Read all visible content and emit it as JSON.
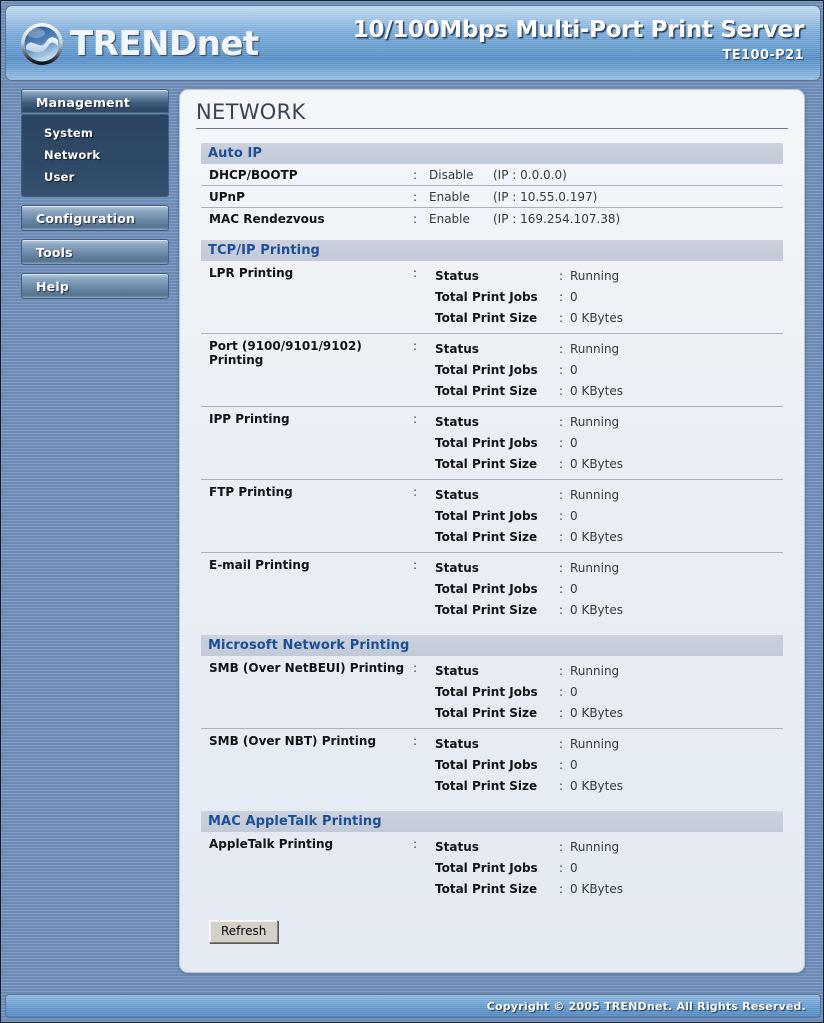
{
  "header": {
    "brand": "TRENDnet",
    "logo_icon": "trendnet-globe-logo",
    "product_title": "10/100Mbps Multi-Port Print Server",
    "model": "TE100-P21"
  },
  "sidebar": {
    "groups": [
      {
        "label": "Management",
        "active": true,
        "items": [
          {
            "label": "System"
          },
          {
            "label": "Network"
          },
          {
            "label": "User"
          }
        ]
      },
      {
        "label": "Configuration",
        "active": false,
        "items": []
      },
      {
        "label": "Tools",
        "active": false,
        "items": []
      },
      {
        "label": "Help",
        "active": false,
        "items": []
      }
    ]
  },
  "main": {
    "page_title": "NETWORK",
    "sections": [
      {
        "title": "Auto IP",
        "type": "simple",
        "rows": [
          {
            "label": "DHCP/BOOTP",
            "colon": ":",
            "value": "Disable",
            "extra": "(IP : 0.0.0.0)"
          },
          {
            "label": "UPnP",
            "colon": ":",
            "value": "Enable",
            "extra": "(IP : 10.55.0.197)"
          },
          {
            "label": "MAC Rendezvous",
            "colon": ":",
            "value": "Enable",
            "extra": "(IP : 169.254.107.38)"
          }
        ]
      },
      {
        "title": "TCP/IP Printing",
        "type": "service",
        "rows": [
          {
            "label": "LPR Printing",
            "colon": ":",
            "lines": [
              {
                "key": "Status",
                "colon": ":",
                "value": "Running"
              },
              {
                "key": "Total Print Jobs",
                "colon": ":",
                "value": "0"
              },
              {
                "key": "Total Print Size",
                "colon": ":",
                "value": "0 KBytes"
              }
            ]
          },
          {
            "label": "Port (9100/9101/9102) Printing",
            "colon": ":",
            "lines": [
              {
                "key": "Status",
                "colon": ":",
                "value": "Running"
              },
              {
                "key": "Total Print Jobs",
                "colon": ":",
                "value": "0"
              },
              {
                "key": "Total Print Size",
                "colon": ":",
                "value": "0 KBytes"
              }
            ]
          },
          {
            "label": "IPP Printing",
            "colon": ":",
            "lines": [
              {
                "key": "Status",
                "colon": ":",
                "value": "Running"
              },
              {
                "key": "Total Print Jobs",
                "colon": ":",
                "value": "0"
              },
              {
                "key": "Total Print Size",
                "colon": ":",
                "value": "0 KBytes"
              }
            ]
          },
          {
            "label": "FTP Printing",
            "colon": ":",
            "lines": [
              {
                "key": "Status",
                "colon": ":",
                "value": "Running"
              },
              {
                "key": "Total Print Jobs",
                "colon": ":",
                "value": "0"
              },
              {
                "key": "Total Print Size",
                "colon": ":",
                "value": "0 KBytes"
              }
            ]
          },
          {
            "label": "E-mail Printing",
            "colon": ":",
            "lines": [
              {
                "key": "Status",
                "colon": ":",
                "value": "Running"
              },
              {
                "key": "Total Print Jobs",
                "colon": ":",
                "value": "0"
              },
              {
                "key": "Total Print Size",
                "colon": ":",
                "value": "0 KBytes"
              }
            ]
          }
        ]
      },
      {
        "title": "Microsoft Network Printing",
        "type": "service",
        "rows": [
          {
            "label": "SMB (Over NetBEUI) Printing",
            "colon": ":",
            "lines": [
              {
                "key": "Status",
                "colon": ":",
                "value": "Running"
              },
              {
                "key": "Total Print Jobs",
                "colon": ":",
                "value": "0"
              },
              {
                "key": "Total Print Size",
                "colon": ":",
                "value": "0 KBytes"
              }
            ]
          },
          {
            "label": "SMB (Over NBT) Printing",
            "colon": ":",
            "lines": [
              {
                "key": "Status",
                "colon": ":",
                "value": "Running"
              },
              {
                "key": "Total Print Jobs",
                "colon": ":",
                "value": "0"
              },
              {
                "key": "Total Print Size",
                "colon": ":",
                "value": "0 KBytes"
              }
            ]
          }
        ]
      },
      {
        "title": "MAC AppleTalk Printing",
        "type": "service",
        "rows": [
          {
            "label": "AppleTalk Printing",
            "colon": ":",
            "lines": [
              {
                "key": "Status",
                "colon": ":",
                "value": "Running"
              },
              {
                "key": "Total Print Jobs",
                "colon": ":",
                "value": "0"
              },
              {
                "key": "Total Print Size",
                "colon": ":",
                "value": "0 KBytes"
              }
            ]
          }
        ]
      }
    ],
    "refresh_label": "Refresh"
  },
  "footer": {
    "copyright": "Copyright © 2005 TRENDnet. All Rights Reserved."
  },
  "colors": {
    "page_background": "#7390b7",
    "section_header_bg": "#c6cdda",
    "section_header_text": "#1c4f96",
    "content_bg": "#eaeff5",
    "menu_active": "#2f4a68"
  }
}
